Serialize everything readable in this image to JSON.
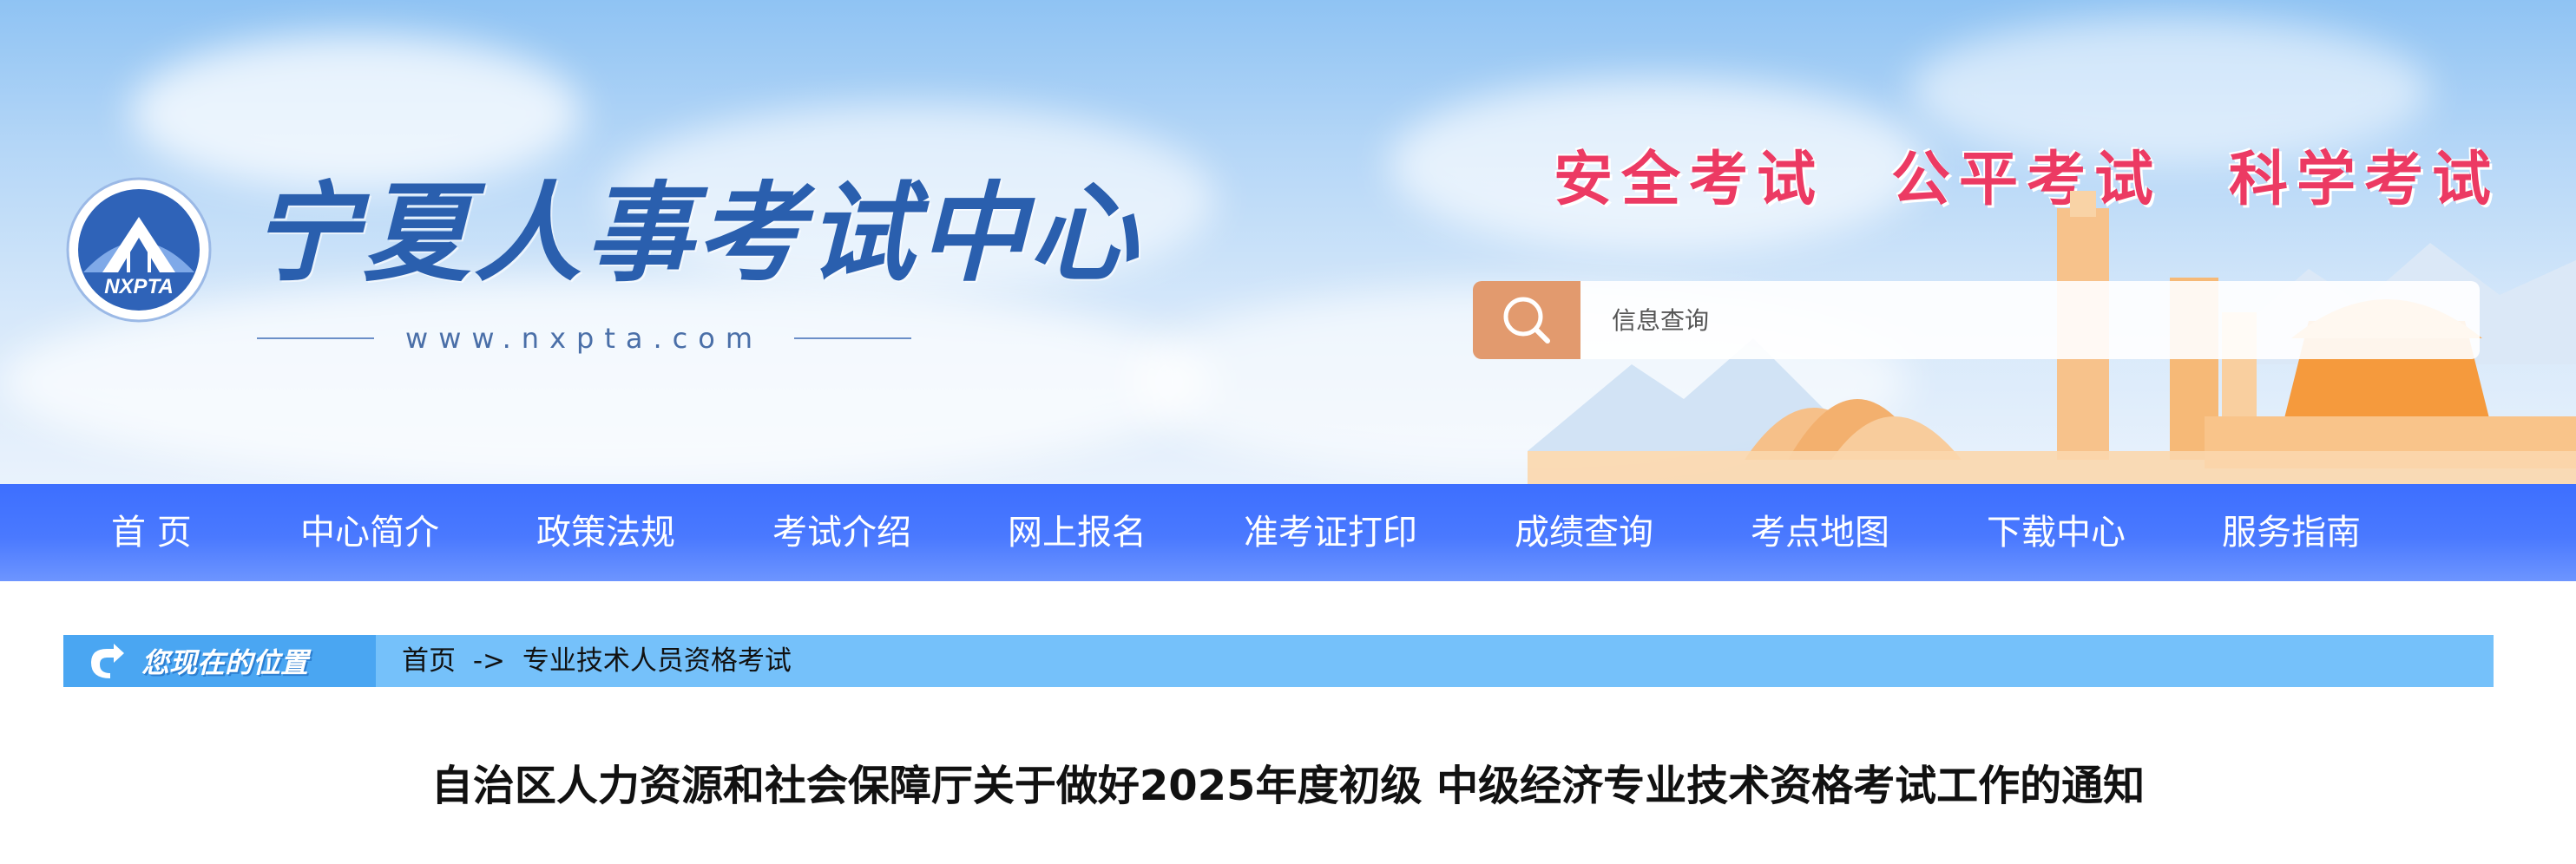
{
  "header": {
    "site_name": "宁夏人事考试中心",
    "url": "www.nxpta.com",
    "logo_text": "NXPTA",
    "slogans": [
      "安全考试",
      "公平考试",
      "科学考试"
    ],
    "slogan_color": "#ec3a63",
    "search": {
      "placeholder": "信息查询",
      "icon": "search-icon",
      "button_color": "#e29a6e"
    }
  },
  "nav": {
    "color": "#4a79ff",
    "items": [
      "首 页",
      "中心简介",
      "政策法规",
      "考试介绍",
      "网上报名",
      "准考证打印",
      "成绩查询",
      "考点地图",
      "下载中心",
      "服务指南"
    ]
  },
  "breadcrumb": {
    "label": "您现在的位置",
    "home": "首页",
    "separator": "->",
    "current": "专业技术人员资格考试"
  },
  "article": {
    "title": "自治区人力资源和社会保障厅关于做好2025年度初级 中级经济专业技术资格考试工作的通知"
  }
}
